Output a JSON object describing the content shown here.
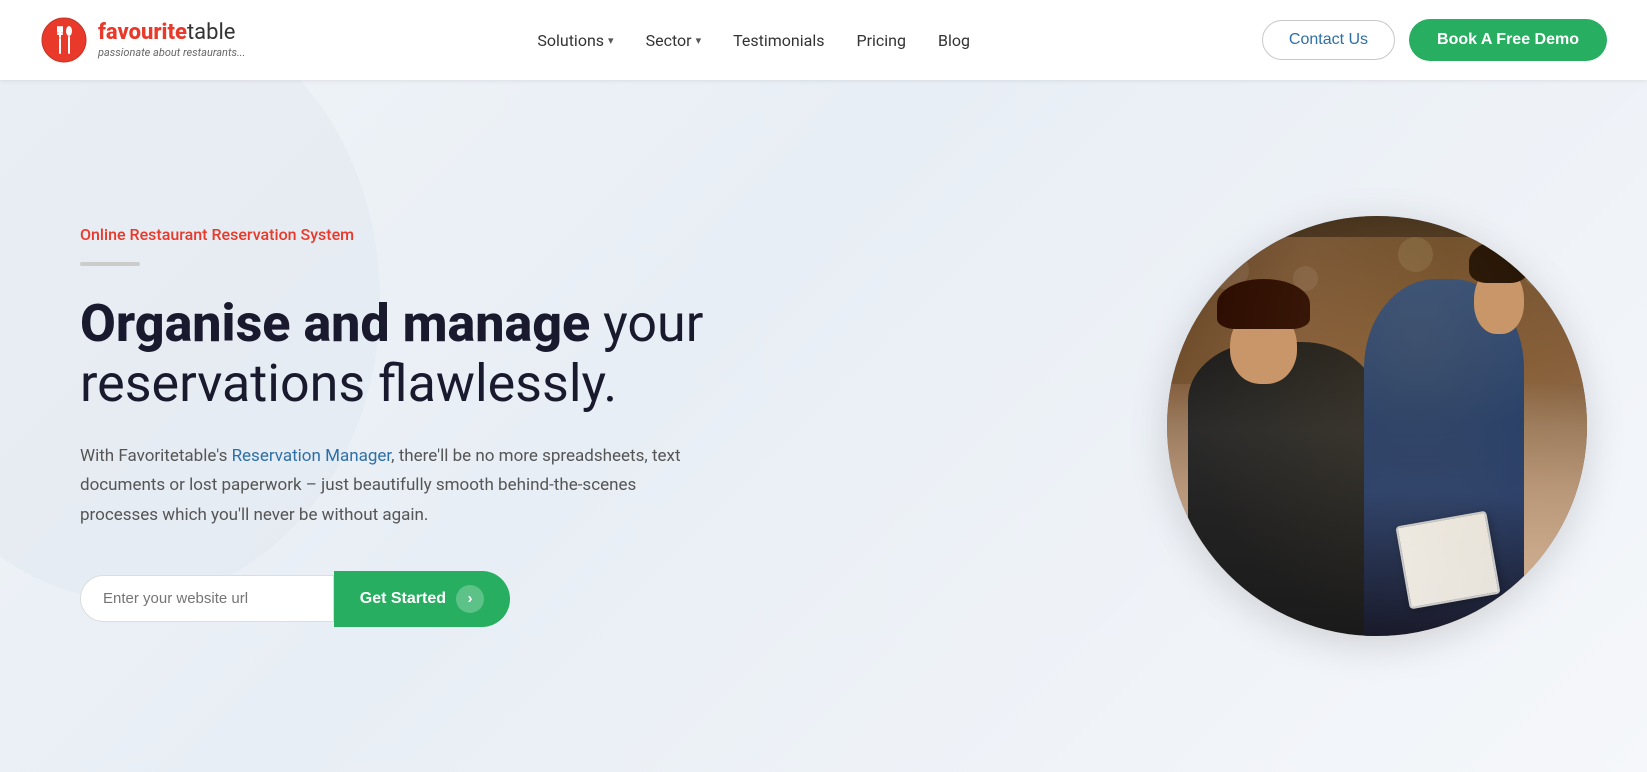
{
  "brand": {
    "name_bold": "favourite",
    "name_normal": "table",
    "tagline": "passionate about restaurants...",
    "logo_alt": "FavouriteTable Logo"
  },
  "navbar": {
    "solutions_label": "Solutions",
    "sector_label": "Sector",
    "testimonials_label": "Testimonials",
    "pricing_label": "Pricing",
    "blog_label": "Blog",
    "contact_label": "Contact Us",
    "demo_label": "Book A Free Demo"
  },
  "hero": {
    "label": "Online Restaurant Reservation System",
    "title_bold": "Organise and manage",
    "title_normal": " your reservations flawlessly.",
    "description": "With Favoritetable's Reservation Manager, there'll be no more spreadsheets, text documents or lost paperwork – just beautifully smooth behind-the-scenes processes which you'll never be without again.",
    "reservation_manager_link": "Reservation Manager",
    "cta_input_placeholder": "Enter your website url",
    "cta_button_label": "Get Started"
  },
  "colors": {
    "accent_red": "#e8392a",
    "accent_green": "#27ae60",
    "accent_blue": "#2d6fa8",
    "text_dark": "#1a1a2e",
    "text_gray": "#555555"
  }
}
